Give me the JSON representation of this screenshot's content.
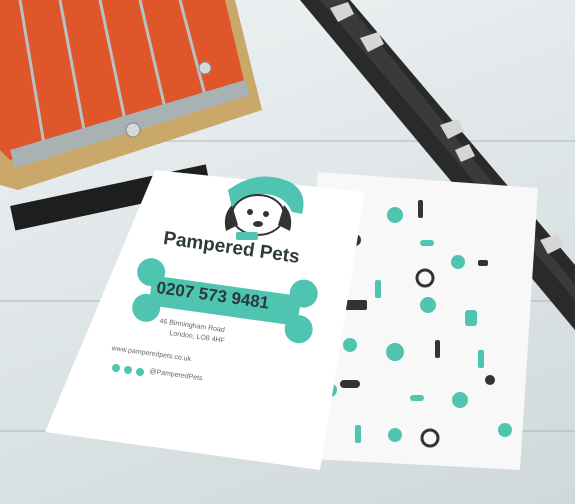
{
  "card": {
    "brand_name": "Pampered Pets",
    "phone": "0207 573 9481",
    "address_line1": "46 Birmingham Road",
    "address_line2": "London, LO8 4HF",
    "website": "www.pamperedpets.co.uk",
    "social_handle": "@PamperedPets"
  },
  "colors": {
    "accent": "#4fc4b1",
    "dark": "#333333",
    "brush_bristle": "#e0562b",
    "brush_wood": "#c9a86a",
    "collar": "#2a2a2a"
  }
}
